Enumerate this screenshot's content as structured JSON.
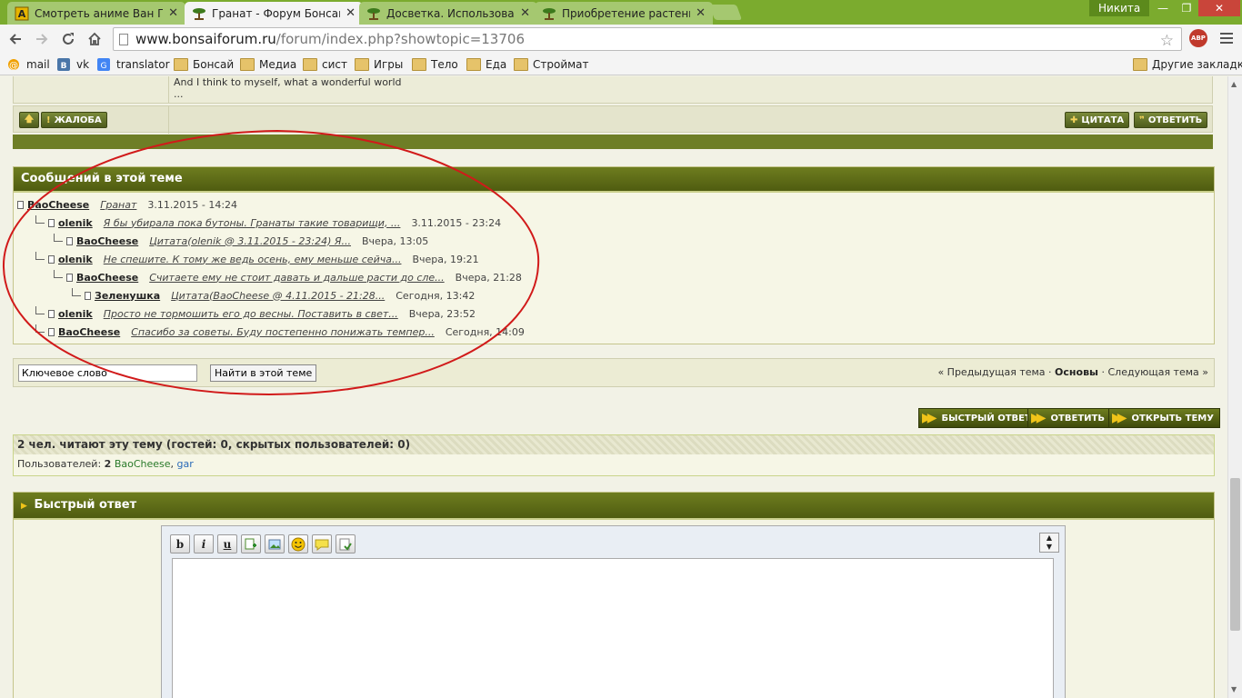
{
  "browser": {
    "tabs": [
      {
        "title": "Смотреть аниме Ван Пис",
        "icon": "anime-site-icon",
        "active": false
      },
      {
        "title": "Гранат - Форум Бонсай",
        "icon": "bonsai-icon",
        "active": true
      },
      {
        "title": "Досветка. Использовани",
        "icon": "bonsai-icon",
        "active": false
      },
      {
        "title": "Приобретение растений",
        "icon": "bonsai-icon",
        "active": false
      }
    ],
    "profile_name": "Никита",
    "url_domain": "www.bonsaiforum.ru",
    "url_path": "/forum/index.php?showtopic=13706",
    "adblock_label": "ABP",
    "bookmarks": [
      {
        "label": "mail",
        "icon": "mail-icon"
      },
      {
        "label": "vk",
        "icon": "vk-icon"
      },
      {
        "label": "translator",
        "icon": "translate-icon"
      },
      {
        "label": "Бонсай",
        "icon": "folder-icon"
      },
      {
        "label": "Медиа",
        "icon": "folder-icon"
      },
      {
        "label": "сист",
        "icon": "folder-icon"
      },
      {
        "label": "Игры",
        "icon": "folder-icon"
      },
      {
        "label": "Тело",
        "icon": "folder-icon"
      },
      {
        "label": "Еда",
        "icon": "folder-icon"
      },
      {
        "label": "Строймат",
        "icon": "folder-icon"
      }
    ],
    "other_bookmarks": "Другие закладки"
  },
  "post": {
    "lyric_line": "And I think to myself, what a wonderful world",
    "lyric_ellipsis": "...",
    "complaint_label": "ЖАЛОБА",
    "quote_label": "ЦИТАТА",
    "reply_label": "ОТВЕТИТЬ"
  },
  "tree": {
    "header": "Сообщений в этой теме",
    "rows": [
      {
        "author": "BaoCheese",
        "title": "Гранат",
        "date": "3.11.2015 - 14:24",
        "depth": 0
      },
      {
        "author": "olenik",
        "title": "Я бы убирала пока бутоны. Гранаты такие товарищи, ...",
        "date": "3.11.2015 - 23:24",
        "depth": 1
      },
      {
        "author": "BaoCheese",
        "title": "Цитата(olenik @ 3.11.2015 - 23:24) Я...",
        "date": "Вчера, 13:05",
        "depth": 2
      },
      {
        "author": "olenik",
        "title": "Не спешите. К тому же ведь осень, ему меньше сейча...",
        "date": "Вчера, 19:21",
        "depth": 1
      },
      {
        "author": "BaoCheese",
        "title": "Считаете ему не стоит давать и дальше расти до сле...",
        "date": "Вчера, 21:28",
        "depth": 2
      },
      {
        "author": "Зеленушка",
        "title": "Цитата(BaoCheese @ 4.11.2015 - 21:28...",
        "date": "Сегодня, 13:42",
        "depth": 3
      },
      {
        "author": "olenik",
        "title": "Просто не тормошить его до весны. Поставить в свет...",
        "date": "Вчера, 23:52",
        "depth": 1
      },
      {
        "author": "BaoCheese",
        "title": "Спасибо за советы. Буду постепенно понижать темпер...",
        "date": "Сегодня, 14:09",
        "depth": 1
      }
    ]
  },
  "search": {
    "value": "Ключевое слово",
    "button": "Найти в этой теме",
    "prev": "« Предыдущая тема",
    "sep": "·",
    "main": "Основы",
    "next": "Следующая тема »"
  },
  "actions": {
    "fast_reply": "БЫСТРЫЙ ОТВЕТ",
    "reply": "ОТВЕТИТЬ",
    "new_topic": "ОТКРЫТЬ ТЕМУ"
  },
  "active": {
    "heading": "2 чел. читают эту тему (гостей: 0, скрытых пользователей: 0)",
    "users_label": "Пользователей:",
    "users_count": "2",
    "users": [
      "BaoCheese",
      "gar"
    ]
  },
  "quick_reply": {
    "header": "Быстрый ответ",
    "toolbar": [
      {
        "label": "b",
        "icon": "bold-icon"
      },
      {
        "label": "i",
        "icon": "italic-icon"
      },
      {
        "label": "u",
        "icon": "underline-icon"
      },
      {
        "label": "",
        "icon": "insert-link-icon"
      },
      {
        "label": "",
        "icon": "insert-image-icon"
      },
      {
        "label": "",
        "icon": "emoticon-icon"
      },
      {
        "label": "",
        "icon": "quote-icon"
      },
      {
        "label": "",
        "icon": "spellcheck-icon"
      }
    ]
  },
  "colors": {
    "header_green": "#5a6818",
    "accent_yellow": "#f0c419",
    "annotation_red": "#d11a1a"
  }
}
